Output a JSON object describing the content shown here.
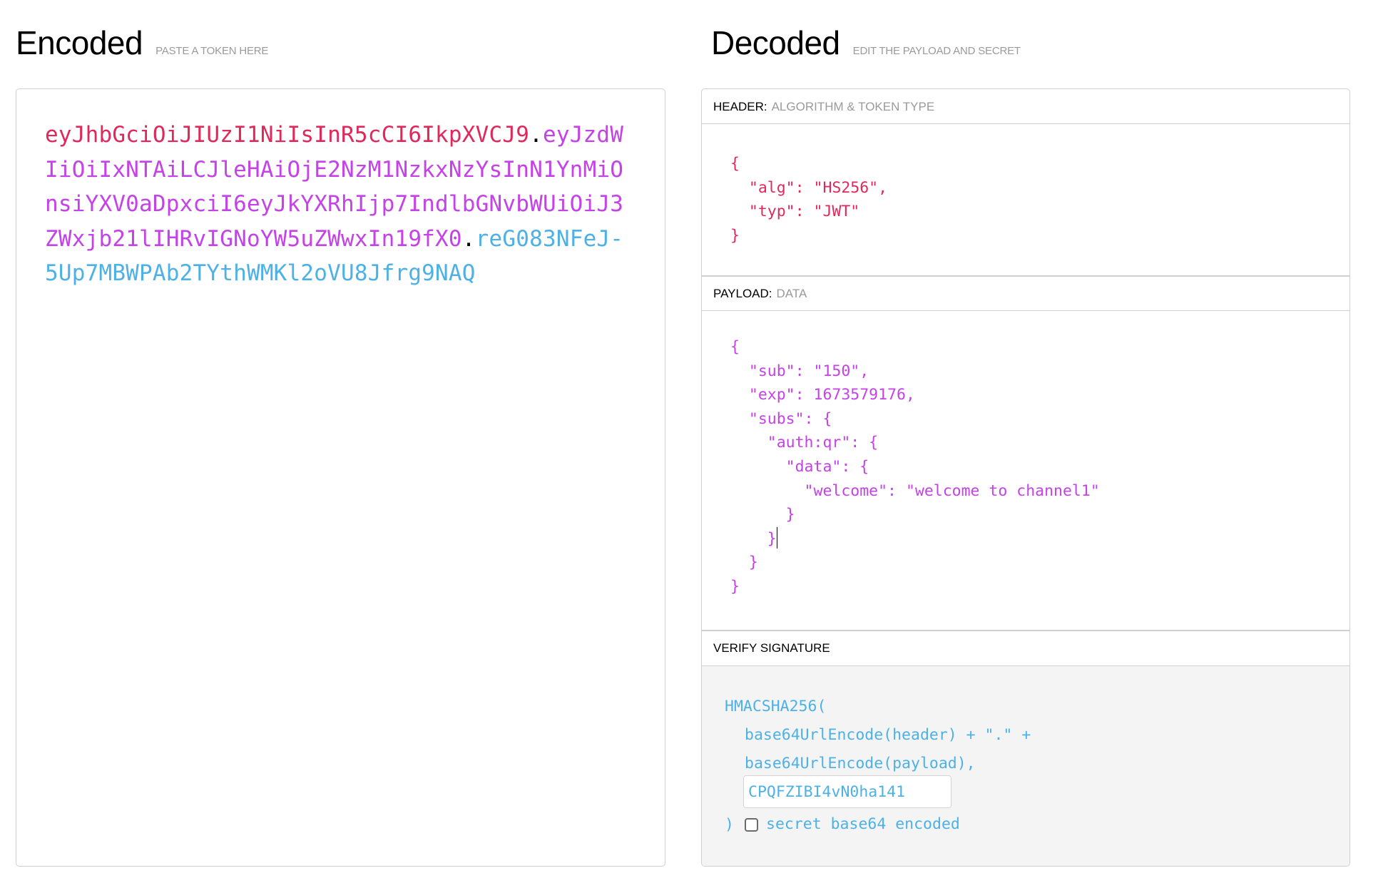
{
  "encoded": {
    "title": "Encoded",
    "subtitle": "PASTE A TOKEN HERE",
    "token": {
      "header": "eyJhbGciOiJIUzI1NiIsInR5cCI6IkpXVCJ9",
      "payload": "eyJzdWIiOiIxNTAiLCJleHAiOjE2NzM1NzkxNzYsInN1YnMiOnsiYXV0aDpxciI6eyJkYXRhIjp7IndlbGNvbWUiOiJ3ZWxjb21lIHRvIGNoYW5uZWwxIn19fX0",
      "signature": "reG083NFeJ-5Up7MBWPAb2TYthWMKl2oVU8Jfrg9NAQ",
      "separator": "."
    },
    "colors": {
      "header": "#e0295a",
      "payload": "#c541e8",
      "signature": "#4db1e6"
    }
  },
  "decoded": {
    "title": "Decoded",
    "subtitle": "EDIT THE PAYLOAD AND SECRET",
    "header_section": {
      "label": "HEADER:",
      "description": "ALGORITHM & TOKEN TYPE",
      "json_text": "{\n  \"alg\": \"HS256\",\n  \"typ\": \"JWT\"\n}"
    },
    "payload_section": {
      "label": "PAYLOAD:",
      "description": "DATA",
      "json_lines": [
        "{",
        "  \"sub\": \"150\",",
        "  \"exp\": 1673579176,",
        "  \"subs\": {",
        "    \"auth:qr\": {",
        "      \"data\": {",
        "        \"welcome\": \"welcome to channel1\"",
        "      }",
        "    }",
        "  }",
        "}"
      ]
    },
    "verify_section": {
      "label": "VERIFY SIGNATURE",
      "func_open": "HMACSHA256(",
      "line_header": "base64UrlEncode(header) + \".\" +",
      "line_payload": "base64UrlEncode(payload),",
      "secret_value": "CPQFZIBI4vN0ha141",
      "func_close": ")",
      "checkbox_label": "secret base64 encoded",
      "checkbox_checked": false
    }
  }
}
